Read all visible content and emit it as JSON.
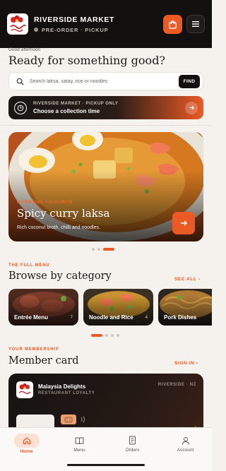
{
  "header": {
    "store_name": "RIVERSIDE MARKET",
    "mode": "PRE-ORDER · PICKUP",
    "logo_icon": "malaysia-delights-logo",
    "logo_text": "Malaysia Delights",
    "accent": "#ec5a24"
  },
  "greeting": {
    "small": "Good afternoon",
    "headline": "Ready for something good?"
  },
  "search": {
    "placeholder": "Search laksa, satay, rice or noodles",
    "button": "FIND",
    "icon": "search-icon"
  },
  "pickup": {
    "line1": "RIVERSIDE MARKET · PICKUP ONLY",
    "line2": "Choose a collection time",
    "icon": "clock-icon"
  },
  "hero": {
    "eyebrow": "RIVERSIDE FAVOURITE",
    "title": "Spicy curry laksa",
    "description": "Rich coconut broth, chilli and noodles.",
    "slide_count": 3,
    "active_slide": 3
  },
  "menu_section": {
    "eyebrow": "THE FULL MENU",
    "title": "Browse by category",
    "see_all": "SEE ALL",
    "categories": [
      {
        "label": "Entrée Menu",
        "count": "7"
      },
      {
        "label": "Noodle and Rice",
        "count": "4"
      },
      {
        "label": "Pork Dishes",
        "count": ""
      }
    ],
    "page_count": 4,
    "active_page": 1
  },
  "membership": {
    "eyebrow": "YOUR MEMBERSHIP",
    "title": "Member card",
    "sign_in": "SIGN IN",
    "card_name": "Malaysia Delights",
    "card_sub": "RESTAURANT LOYALTY",
    "card_location": "RIVERSIDE · NZ"
  },
  "tabs": [
    {
      "label": "Home",
      "icon": "home-icon",
      "active": true
    },
    {
      "label": "Menu",
      "icon": "book-icon",
      "active": false
    },
    {
      "label": "Orders",
      "icon": "receipt-icon",
      "active": false
    },
    {
      "label": "Account",
      "icon": "person-icon",
      "active": false
    }
  ]
}
